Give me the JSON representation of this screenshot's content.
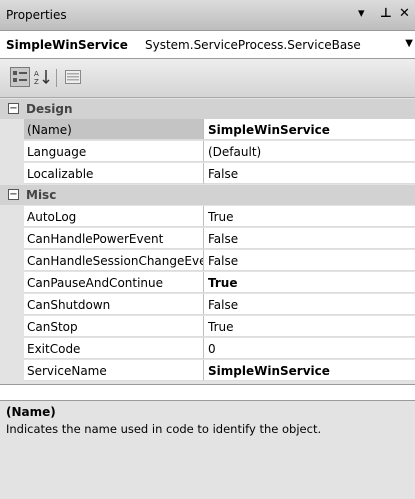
{
  "window": {
    "title": "Properties",
    "dropdown_icon": "▾",
    "pin_icon": "⊥",
    "close_icon": "✕"
  },
  "object": {
    "name": "SimpleWinService",
    "type": "System.ServiceProcess.ServiceBase"
  },
  "toolbar": {
    "categorized_icon": "categorized-icon",
    "alphabetical_icon": "alphabetical-icon",
    "pages_icon": "property-pages-icon"
  },
  "categories": {
    "design": {
      "label": "Design",
      "toggle": "−",
      "properties": [
        {
          "name": "(Name)",
          "value": "SimpleWinService"
        },
        {
          "name": "Language",
          "value": "(Default)"
        },
        {
          "name": "Localizable",
          "value": "False"
        }
      ]
    },
    "misc": {
      "label": "Misc",
      "toggle": "−",
      "properties": [
        {
          "name": "AutoLog",
          "value": "True"
        },
        {
          "name": "CanHandlePowerEvent",
          "value": "False"
        },
        {
          "name": "CanHandleSessionChangeEvent",
          "value": "False"
        },
        {
          "name": "CanPauseAndContinue",
          "value": "True"
        },
        {
          "name": "CanShutdown",
          "value": "False"
        },
        {
          "name": "CanStop",
          "value": "True"
        },
        {
          "name": "ExitCode",
          "value": "0"
        },
        {
          "name": "ServiceName",
          "value": "SimpleWinService"
        }
      ]
    }
  },
  "description": {
    "title": "(Name)",
    "text": "Indicates the name used in code to identify the object."
  },
  "colors": {
    "selected_row": "#c4c4c4",
    "category_bg": "#d2d2d2"
  }
}
